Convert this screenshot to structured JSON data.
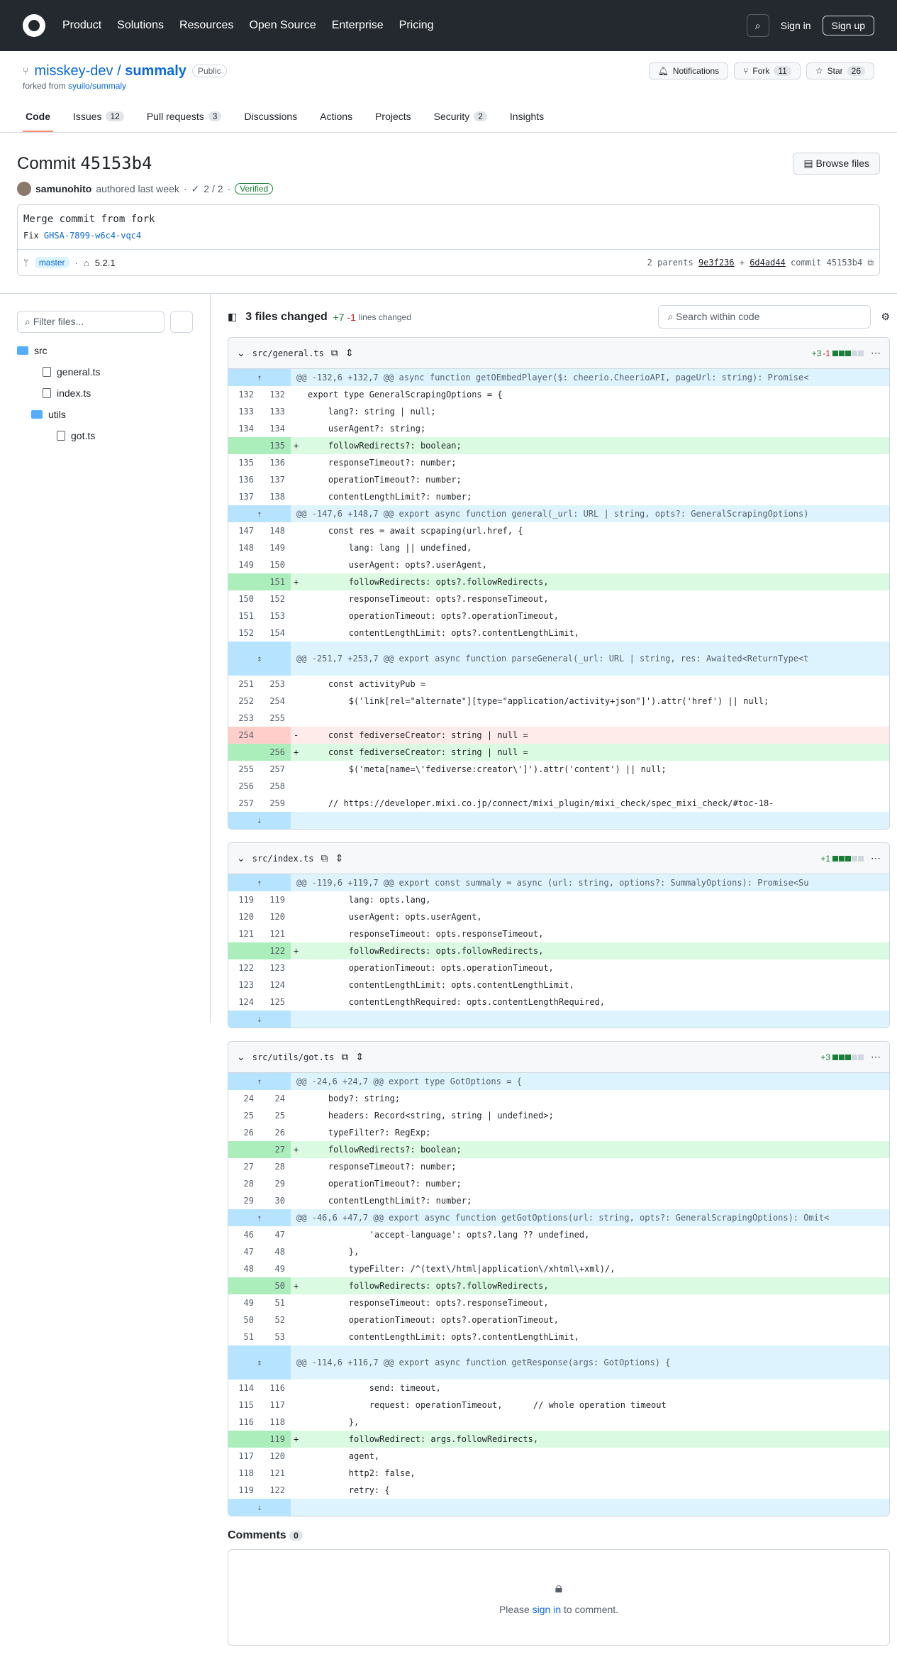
{
  "nav": {
    "items": [
      "Product",
      "Solutions",
      "Resources",
      "Open Source",
      "Enterprise",
      "Pricing"
    ],
    "sign_in": "Sign in",
    "sign_up": "Sign up"
  },
  "repo": {
    "owner": "misskey-dev",
    "name": "summaly",
    "visibility": "Public",
    "forked_text": "forked from",
    "forked_repo": "syuilo/summaly",
    "notifications": "Notifications",
    "fork": "Fork",
    "fork_count": "11",
    "star": "Star",
    "star_count": "26"
  },
  "tabs": [
    {
      "label": "Code",
      "count": ""
    },
    {
      "label": "Issues",
      "count": "12"
    },
    {
      "label": "Pull requests",
      "count": "3"
    },
    {
      "label": "Discussions",
      "count": ""
    },
    {
      "label": "Actions",
      "count": ""
    },
    {
      "label": "Projects",
      "count": ""
    },
    {
      "label": "Security",
      "count": "2"
    },
    {
      "label": "Insights",
      "count": ""
    }
  ],
  "commit": {
    "title": "Commit",
    "sha": "45153b4",
    "browse": "Browse files",
    "author": "samunohito",
    "authored": "authored last week",
    "checks": "2 / 2",
    "verified": "Verified",
    "msg_title": "Merge commit from fork",
    "msg_fix": "Fix",
    "msg_link": "GHSA-7899-w6c4-vqc4",
    "branch": "master",
    "tag": "5.2.1",
    "parents": "2 parents",
    "p1": "9e3f236",
    "p2": "6d4ad44",
    "commit_label": "commit"
  },
  "sidebar": {
    "filter": "Filter files...",
    "tree": [
      {
        "label": "src",
        "type": "folder",
        "level": 0
      },
      {
        "label": "general.ts",
        "type": "file",
        "level": 1
      },
      {
        "label": "index.ts",
        "type": "file",
        "level": 1
      },
      {
        "label": "utils",
        "type": "folder",
        "level": 1
      },
      {
        "label": "got.ts",
        "type": "file",
        "level": 2
      }
    ]
  },
  "summary": {
    "files": "3 files changed",
    "add": "+7",
    "del": "-1",
    "lines": "lines changed",
    "search": "Search within code"
  },
  "files": [
    {
      "path": "src/general.ts",
      "add": "+3",
      "del": "-1",
      "rows": [
        [
          "hk",
          "",
          "",
          "@@ -132,6 +132,7 @@ async function getOEmbedPlayer($: cheerio.CheerioAPI, pageUrl: string): Promise<"
        ],
        [
          "c",
          "132",
          "132",
          "export type GeneralScrapingOptions = {"
        ],
        [
          "c",
          "133",
          "133",
          "\tlang?: string | null;"
        ],
        [
          "c",
          "134",
          "134",
          "\tuserAgent?: string;"
        ],
        [
          "a",
          "",
          "135",
          "\tfollowRedirects?: boolean;"
        ],
        [
          "c",
          "135",
          "136",
          "\tresponseTimeout?: number;"
        ],
        [
          "c",
          "136",
          "137",
          "\toperationTimeout?: number;"
        ],
        [
          "c",
          "137",
          "138",
          "\tcontentLengthLimit?: number;"
        ],
        [
          "hk",
          "",
          "",
          "@@ -147,6 +148,7 @@ export async function general(_url: URL | string, opts?: GeneralScrapingOptions)"
        ],
        [
          "c",
          "147",
          "148",
          "\tconst res = await scpaping(url.href, {"
        ],
        [
          "c",
          "148",
          "149",
          "\t\tlang: lang || undefined,"
        ],
        [
          "c",
          "149",
          "150",
          "\t\tuserAgent: opts?.userAgent,"
        ],
        [
          "a",
          "",
          "151",
          "\t\tfollowRedirects: opts?.followRedirects,"
        ],
        [
          "c",
          "150",
          "152",
          "\t\tresponseTimeout: opts?.responseTimeout,"
        ],
        [
          "c",
          "151",
          "153",
          "\t\toperationTimeout: opts?.operationTimeout,"
        ],
        [
          "c",
          "152",
          "154",
          "\t\tcontentLengthLimit: opts?.contentLengthLimit,"
        ],
        [
          "hk2",
          "",
          "",
          "@@ -251,7 +253,7 @@ export async function parseGeneral(_url: URL | string, res: Awaited<ReturnType<t"
        ],
        [
          "c",
          "251",
          "253",
          "\tconst activityPub ="
        ],
        [
          "c",
          "252",
          "254",
          "\t\t$('link[rel=\"alternate\"][type=\"application/activity+json\"]').attr('href') || null;"
        ],
        [
          "c",
          "253",
          "255",
          ""
        ],
        [
          "d",
          "254",
          "",
          "\tconst fediverseCreator: string | null ="
        ],
        [
          "a",
          "",
          "256",
          "\tconst fediverseCreator: string | null ="
        ],
        [
          "c",
          "255",
          "257",
          "\t\t$('meta[name=\\'fediverse:creator\\']').attr('content') || null;"
        ],
        [
          "c",
          "256",
          "258",
          ""
        ],
        [
          "c",
          "257",
          "259",
          "\t// https://developer.mixi.co.jp/connect/mixi_plugin/mixi_check/spec_mixi_check/#toc-18-"
        ],
        [
          "exp",
          "",
          "",
          ""
        ]
      ]
    },
    {
      "path": "src/index.ts",
      "add": "+1",
      "del": "",
      "rows": [
        [
          "hk",
          "",
          "",
          "@@ -119,6 +119,7 @@ export const summaly = async (url: string, options?: SummalyOptions): Promise<Su"
        ],
        [
          "c",
          "119",
          "119",
          "\t\tlang: opts.lang,"
        ],
        [
          "c",
          "120",
          "120",
          "\t\tuserAgent: opts.userAgent,"
        ],
        [
          "c",
          "121",
          "121",
          "\t\tresponseTimeout: opts.responseTimeout,"
        ],
        [
          "a",
          "",
          "122",
          "\t\tfollowRedirects: opts.followRedirects,"
        ],
        [
          "c",
          "122",
          "123",
          "\t\toperationTimeout: opts.operationTimeout,"
        ],
        [
          "c",
          "123",
          "124",
          "\t\tcontentLengthLimit: opts.contentLengthLimit,"
        ],
        [
          "c",
          "124",
          "125",
          "\t\tcontentLengthRequired: opts.contentLengthRequired,"
        ],
        [
          "exp",
          "",
          "",
          ""
        ]
      ]
    },
    {
      "path": "src/utils/got.ts",
      "add": "+3",
      "del": "",
      "rows": [
        [
          "hk",
          "",
          "",
          "@@ -24,6 +24,7 @@ export type GotOptions = {"
        ],
        [
          "c",
          "24",
          "24",
          "\tbody?: string;"
        ],
        [
          "c",
          "25",
          "25",
          "\theaders: Record<string, string | undefined>;"
        ],
        [
          "c",
          "26",
          "26",
          "\ttypeFilter?: RegExp;"
        ],
        [
          "a",
          "",
          "27",
          "\tfollowRedirects?: boolean;"
        ],
        [
          "c",
          "27",
          "28",
          "\tresponseTimeout?: number;"
        ],
        [
          "c",
          "28",
          "29",
          "\toperationTimeout?: number;"
        ],
        [
          "c",
          "29",
          "30",
          "\tcontentLengthLimit?: number;"
        ],
        [
          "hk",
          "",
          "",
          "@@ -46,6 +47,7 @@ export async function getGotOptions(url: string, opts?: GeneralScrapingOptions): Omit<"
        ],
        [
          "c",
          "46",
          "47",
          "\t\t\t'accept-language': opts?.lang ?? undefined,"
        ],
        [
          "c",
          "47",
          "48",
          "\t\t},"
        ],
        [
          "c",
          "48",
          "49",
          "\t\ttypeFilter: /^(text\\/html|application\\/xhtml\\+xml)/,"
        ],
        [
          "a",
          "",
          "50",
          "\t\tfollowRedirects: opts?.followRedirects,"
        ],
        [
          "c",
          "49",
          "51",
          "\t\tresponseTimeout: opts?.responseTimeout,"
        ],
        [
          "c",
          "50",
          "52",
          "\t\toperationTimeout: opts?.operationTimeout,"
        ],
        [
          "c",
          "51",
          "53",
          "\t\tcontentLengthLimit: opts?.contentLengthLimit,"
        ],
        [
          "hk2",
          "",
          "",
          "@@ -114,6 +116,7 @@ export async function getResponse(args: GotOptions) {"
        ],
        [
          "c",
          "114",
          "116",
          "\t\t\tsend: timeout,"
        ],
        [
          "c",
          "115",
          "117",
          "\t\t\trequest: operationTimeout,      // whole operation timeout"
        ],
        [
          "c",
          "116",
          "118",
          "\t\t},"
        ],
        [
          "a",
          "",
          "119",
          "\t\tfollowRedirect: args.followRedirects,"
        ],
        [
          "c",
          "117",
          "120",
          "\t\tagent,"
        ],
        [
          "c",
          "118",
          "121",
          "\t\thttp2: false,"
        ],
        [
          "c",
          "119",
          "122",
          "\t\tretry: {"
        ],
        [
          "exp",
          "",
          "",
          ""
        ]
      ]
    }
  ],
  "comments": {
    "title": "Comments",
    "count": "0",
    "please": "Please",
    "sign_in": "sign in",
    "to_comment": "to comment."
  }
}
